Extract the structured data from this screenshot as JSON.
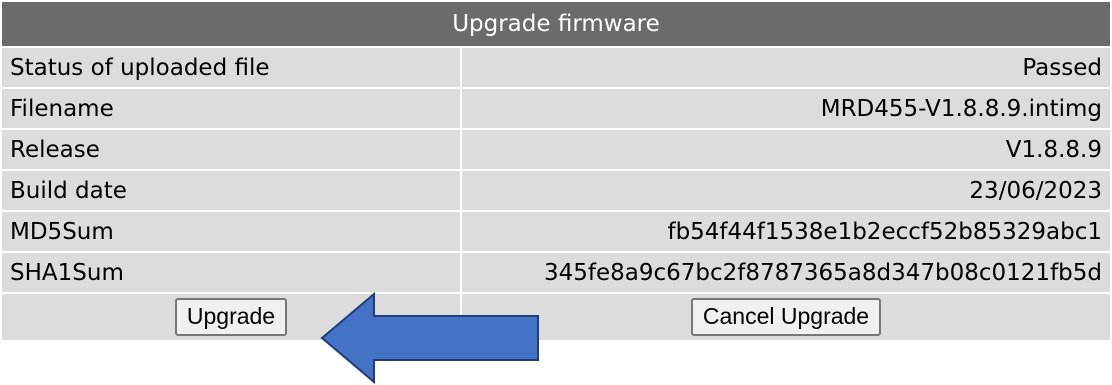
{
  "panel": {
    "title": "Upgrade firmware"
  },
  "rows": [
    {
      "label": "Status of uploaded file",
      "value": "Passed"
    },
    {
      "label": "Filename",
      "value": "MRD455-V1.8.8.9.intimg"
    },
    {
      "label": "Release",
      "value": "V1.8.8.9"
    },
    {
      "label": "Build date",
      "value": "23/06/2023"
    },
    {
      "label": "MD5Sum",
      "value": "fb54f44f1538e1b2eccf52b85329abc1"
    },
    {
      "label": "SHA1Sum",
      "value": "345fe8a9c67bc2f8787365a8d347b08c0121fb5d"
    }
  ],
  "buttons": {
    "upgrade_label": "Upgrade",
    "cancel_label": "Cancel Upgrade"
  },
  "annotation": {
    "arrow_icon": "left-arrow-icon",
    "arrow_fill": "#4472c4",
    "arrow_stroke": "#1f3d7a"
  }
}
